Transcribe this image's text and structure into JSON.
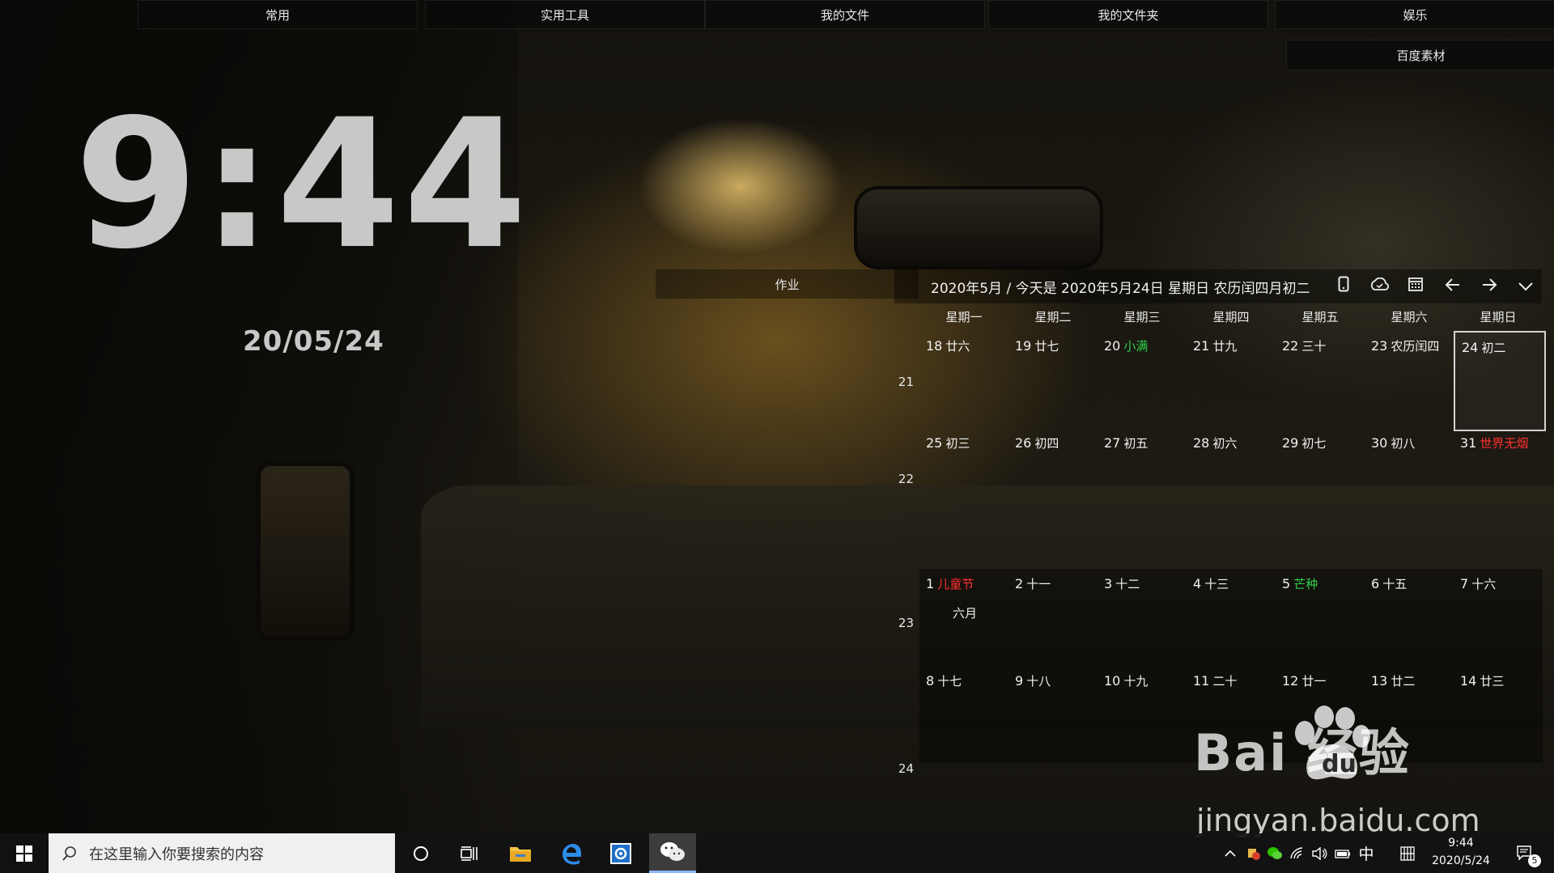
{
  "top_tabs": [
    "常用",
    "实用工具",
    "我的文件",
    "我的文件夹",
    "娱乐"
  ],
  "sub_tab": "百度素材",
  "clock": {
    "time": "9:44",
    "date": "20/05/24"
  },
  "work_title": "作业",
  "calendar": {
    "title": "2020年5月 / 今天是 2020年5月24日 星期日 农历闰四月初二",
    "weekdays": [
      "星期一",
      "星期二",
      "星期三",
      "星期四",
      "星期五",
      "星期六",
      "星期日"
    ],
    "week_numbers": [
      "21",
      "22",
      "23",
      "24"
    ],
    "next_month_label": "六月",
    "weeks": [
      [
        {
          "d": "18",
          "l": "廿六"
        },
        {
          "d": "19",
          "l": "廿七"
        },
        {
          "d": "20",
          "l": "小满",
          "c": "green"
        },
        {
          "d": "21",
          "l": "廿九"
        },
        {
          "d": "22",
          "l": "三十"
        },
        {
          "d": "23",
          "l": "农历闰四"
        },
        {
          "d": "24",
          "l": "初二",
          "sel": true
        }
      ],
      [
        {
          "d": "25",
          "l": "初三"
        },
        {
          "d": "26",
          "l": "初四"
        },
        {
          "d": "27",
          "l": "初五"
        },
        {
          "d": "28",
          "l": "初六"
        },
        {
          "d": "29",
          "l": "初七"
        },
        {
          "d": "30",
          "l": "初八"
        },
        {
          "d": "31",
          "l": "世界无烟",
          "c": "red"
        }
      ],
      [
        {
          "d": "1",
          "l": "儿童节",
          "c": "red"
        },
        {
          "d": "2",
          "l": "十一"
        },
        {
          "d": "3",
          "l": "十二"
        },
        {
          "d": "4",
          "l": "十三"
        },
        {
          "d": "5",
          "l": "芒种",
          "c": "green"
        },
        {
          "d": "6",
          "l": "十五"
        },
        {
          "d": "7",
          "l": "十六"
        }
      ],
      [
        {
          "d": "8",
          "l": "十七"
        },
        {
          "d": "9",
          "l": "十八"
        },
        {
          "d": "10",
          "l": "十九"
        },
        {
          "d": "11",
          "l": "二十"
        },
        {
          "d": "12",
          "l": "廿一"
        },
        {
          "d": "13",
          "l": "廿二"
        },
        {
          "d": "14",
          "l": "廿三"
        }
      ]
    ]
  },
  "watermark": {
    "logo": "Bai  经验",
    "url": "jingyan.baidu.com"
  },
  "taskbar": {
    "search_placeholder": "在这里输入你要搜索的内容",
    "ime": "中",
    "time": "9:44",
    "date": "2020/5/24",
    "notification_count": "5"
  }
}
